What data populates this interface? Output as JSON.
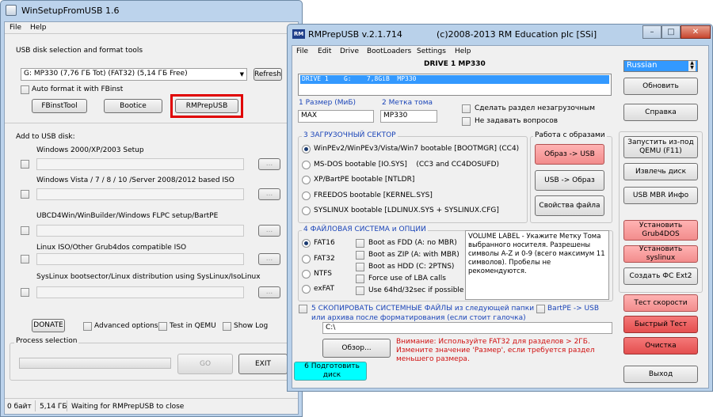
{
  "win1": {
    "title": "WinSetupFromUSB 1.6",
    "menu": [
      "File",
      "Help"
    ],
    "usb_section_label": "USB disk selection and format tools",
    "disk_selected": "G: MP330 (7,76 ГБ Tot) (FAT32) (5,14 ГБ Free)",
    "refresh_label": "Refresh",
    "auto_format_label": "Auto format it with FBinst",
    "fbinst_tool_label": "FBinstTool",
    "bootice_label": "Bootice",
    "rmprepusb_label": "RMPrepUSB",
    "add_label": "Add to USB disk:",
    "sources": [
      {
        "label": "Windows 2000/XP/2003 Setup"
      },
      {
        "label": "Windows Vista / 7 / 8 / 10 /Server 2008/2012 based ISO"
      },
      {
        "label": "UBCD4Win/WinBuilder/Windows FLPC setup/BartPE"
      },
      {
        "label": "Linux ISO/Other Grub4dos compatible ISO"
      },
      {
        "label": "SysLinux bootsector/Linux distribution using SysLinux/IsoLinux"
      }
    ],
    "browse_label": "...",
    "donate_label": "DONATE",
    "advanced_label": "Advanced options",
    "test_qemu_label": "Test in QEMU",
    "show_log_label": "Show Log",
    "process_label": "Process selection",
    "go_label": "GO",
    "exit_label": "EXIT",
    "status": [
      "0 байт",
      "5,14 ГБ",
      "Waiting for RMPrepUSB to close"
    ]
  },
  "win2": {
    "title": "RMPrepUSB v.2.1.714",
    "copyright": "(c)2008-2013 RM Education plc [SSi]",
    "icon_text": "RM",
    "menu": [
      "File",
      "Edit",
      "Drive",
      "BootLoaders",
      "Settings",
      "Help"
    ],
    "drive_header": "DRIVE 1  MP330",
    "drive_row": "DRIVE 1    G:    7,8GiB  MP330",
    "language": "Russian",
    "update_label": "Обновить",
    "help_label": "Справка",
    "size_label": "1 Размер (МиБ)",
    "size_value": "MAX",
    "volume_label_label": "2 Метка тома",
    "volume_value": "MP330",
    "no_partition_label": "Сделать раздел незагрузочным",
    "no_prompt_label": "Не задавать вопросов",
    "boot_section_label": "3 ЗАГРУЗОЧНЫЙ СЕКТОР",
    "boot_options": [
      "WinPEv2/WinPEv3/Vista/Win7 bootable [BOOTMGR] (CC4)",
      "MS-DOS bootable [IO.SYS]    (CC3 and CC4DOSUFD)",
      "XP/BartPE bootable [NTLDR]",
      "FREEDOS bootable [KERNEL.SYS]",
      "SYSLINUX bootable [LDLINUX.SYS + SYSLINUX.CFG]"
    ],
    "images_group_label": "Работа с образами",
    "img_to_usb_label": "Образ -> USB",
    "usb_to_img_label": "USB -> Образ",
    "file_props_label": "Свойства файла",
    "run_qemu_label": "Запустить из-под QEMU (F11)",
    "eject_label": "Извлечь диск",
    "usb_mbr_label": "USB MBR Инфо",
    "install_grub_label": "Установить Grub4DOS",
    "install_syslinux_label": "Установить syslinux",
    "create_ext2_label": "Создать ФС Ext2",
    "speed_test_label": "Тест скорости",
    "quick_test_label": "Быстрый Тест",
    "clean_label": "Очистка",
    "exit_label": "Выход",
    "fs_section_label": "4 ФАЙЛОВАЯ СИСТЕМА и ОПЦИИ",
    "fs_options": [
      "FAT16",
      "FAT32",
      "NTFS",
      "exFAT"
    ],
    "boot_as_options": [
      "Boot as FDD (A: no MBR)",
      "Boot as ZIP (A: with MBR)",
      "Boot as HDD (C: 2PTNS)",
      "Force use of LBA calls",
      "Use 64hd/32sec if possible"
    ],
    "info_text": "VOLUME LABEL - Укажите Метку Тома выбранного носителя. Разрешены символы A-Z и 0-9 (всего максимум 11 символов). Пробелы не рекомендуются.",
    "copy_files_label": "5 СКОПИРОВАТЬ СИСТЕМНЫЕ ФАЙЛЫ из следующей папки или архива после форматирования (если стоит галочка)",
    "bartpe_label": "BartPE -> USB",
    "path_value": "C:\\",
    "browse_label": "Обзор...",
    "warning_text": "Внимание: Используйте FAT32 для разделов > 2ГБ. Измените значение 'Размер', если требуется раздел меньшего размера.",
    "prepare_label": "6 Подготовить диск"
  }
}
